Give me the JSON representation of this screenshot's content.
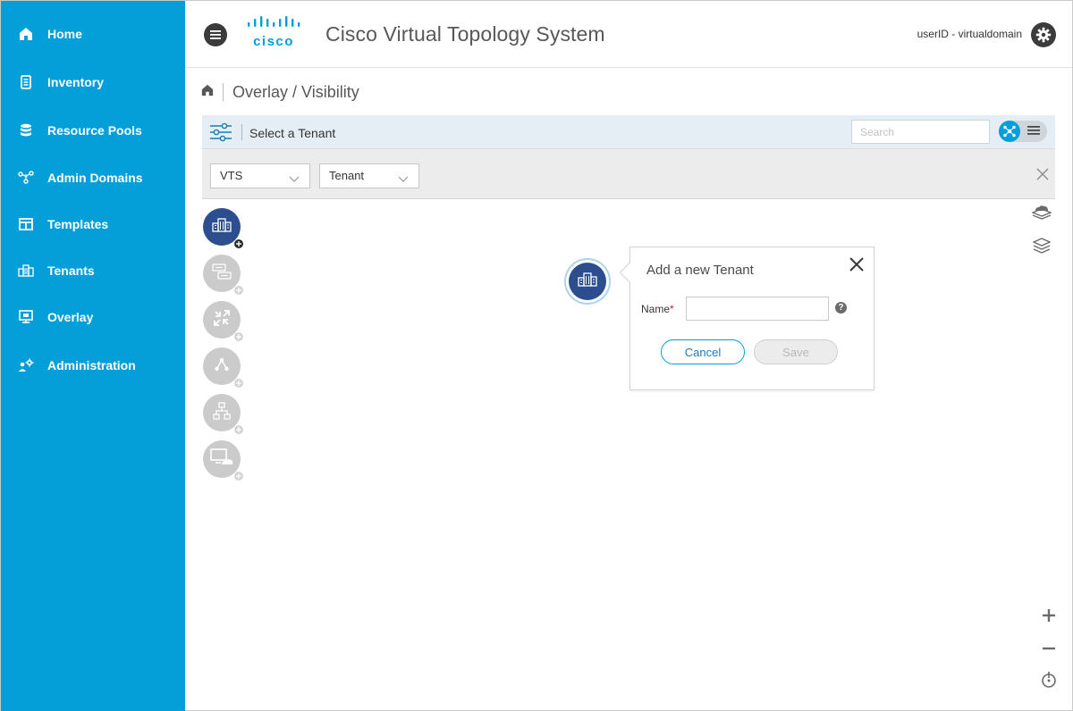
{
  "sidebar": {
    "items": [
      {
        "label": "Home",
        "icon": "home-icon"
      },
      {
        "label": "Inventory",
        "icon": "inventory-icon"
      },
      {
        "label": "Resource Pools",
        "icon": "database-icon"
      },
      {
        "label": "Admin Domains",
        "icon": "admin-domains-icon"
      },
      {
        "label": "Templates",
        "icon": "templates-icon"
      },
      {
        "label": "Tenants",
        "icon": "tenants-icon"
      },
      {
        "label": "Overlay",
        "icon": "monitor-icon"
      },
      {
        "label": "Administration",
        "icon": "administration-icon"
      }
    ],
    "background": "#049fd9"
  },
  "header": {
    "logo_text": "cisco",
    "title": "Cisco Virtual Topology System",
    "user": "userID - virtualdomain"
  },
  "breadcrumb": {
    "text": "Overlay / Visibility"
  },
  "filter_bar": {
    "label": "Select a Tenant",
    "search_placeholder": "Search"
  },
  "dropdowns": {
    "vts": "VTS",
    "tenant": "Tenant"
  },
  "tools": [
    {
      "name": "tenant-tool",
      "icon": "building-icon",
      "active": true
    },
    {
      "name": "network-tool",
      "icon": "network-icon",
      "active": false
    },
    {
      "name": "router-tool",
      "icon": "router-icon",
      "active": false
    },
    {
      "name": "topology-tool",
      "icon": "topology-icon",
      "active": false
    },
    {
      "name": "hierarchy-tool",
      "icon": "hierarchy-icon",
      "active": false
    },
    {
      "name": "cloud-vm-tool",
      "icon": "cloud-vm-icon",
      "active": false
    }
  ],
  "popover": {
    "title": "Add a new Tenant",
    "name_label": "Name",
    "required_mark": "*",
    "name_value": "",
    "help": "?",
    "cancel_label": "Cancel",
    "save_label": "Save"
  },
  "colors": {
    "accent": "#049fd9",
    "node": "#2d4e8e",
    "required": "#cf2030"
  }
}
